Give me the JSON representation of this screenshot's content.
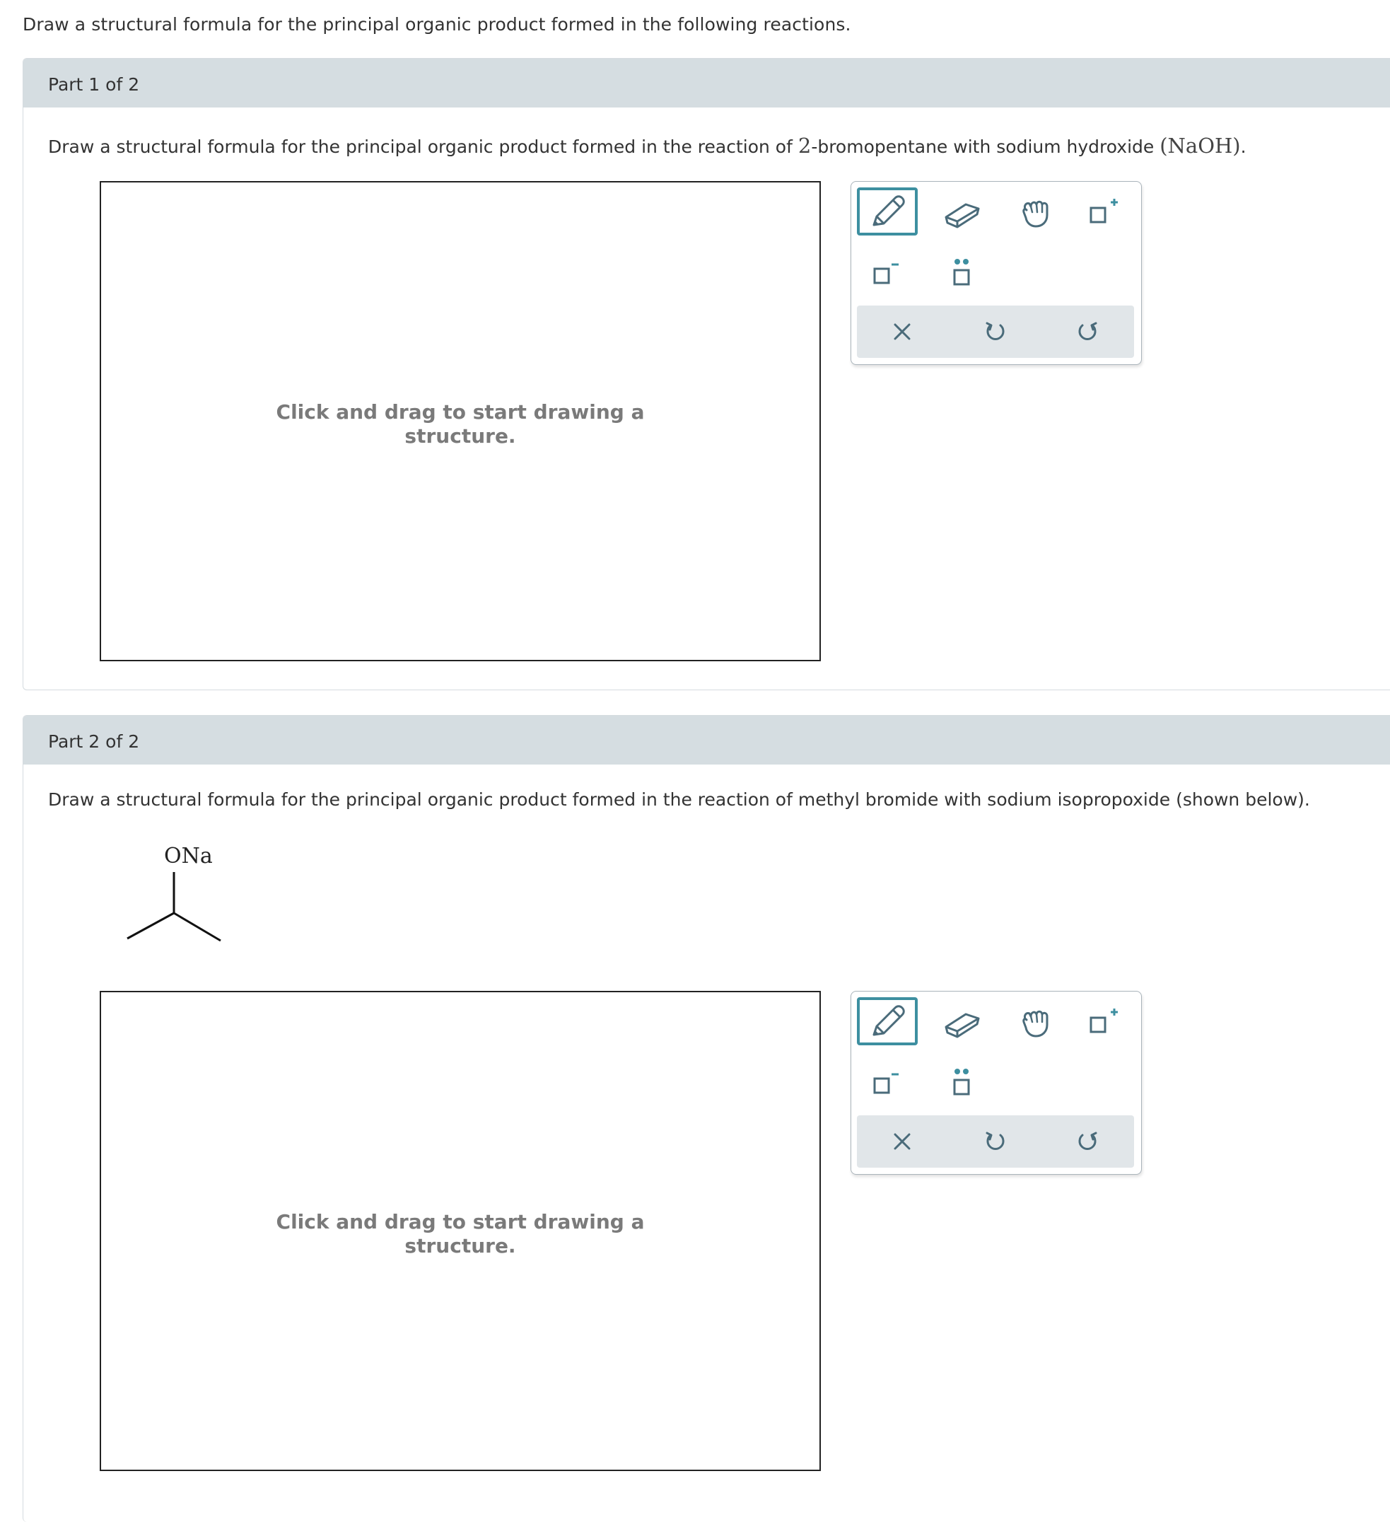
{
  "instruction": "Draw a structural formula for the principal organic product formed in the following reactions.",
  "parts": [
    {
      "header": "Part 1 of 2",
      "question_prefix": "Draw a structural formula for the principal organic product formed in the reaction of ",
      "question_number": "2",
      "question_middle": "-bromopentane with sodium hydroxide ",
      "question_formula": "(NaOH)",
      "question_suffix": ".",
      "canvas_hint_line1": "Click and drag to start drawing a",
      "canvas_hint_line2": "structure."
    },
    {
      "header": "Part 2 of 2",
      "question": "Draw a structural formula for the principal organic product formed in the reaction of methyl bromide with sodium isopropoxide (shown below).",
      "molecule_label": "ONa",
      "canvas_hint_line1": "Click and drag to start drawing a",
      "canvas_hint_line2": "structure."
    }
  ],
  "toolbar_icons": {
    "tools": [
      "pencil-icon",
      "eraser-icon",
      "hand-icon",
      "cation-charge-icon",
      "anion-charge-icon",
      "lone-pair-icon"
    ],
    "actions": [
      "clear-icon",
      "undo-icon",
      "redo-icon"
    ]
  },
  "colors": {
    "accent": "#3d8fa0",
    "icon": "#4a6b7a",
    "header_bg": "#d5dde1",
    "action_bar_bg": "#e1e6e9",
    "hint_text": "#7a7a7a"
  }
}
